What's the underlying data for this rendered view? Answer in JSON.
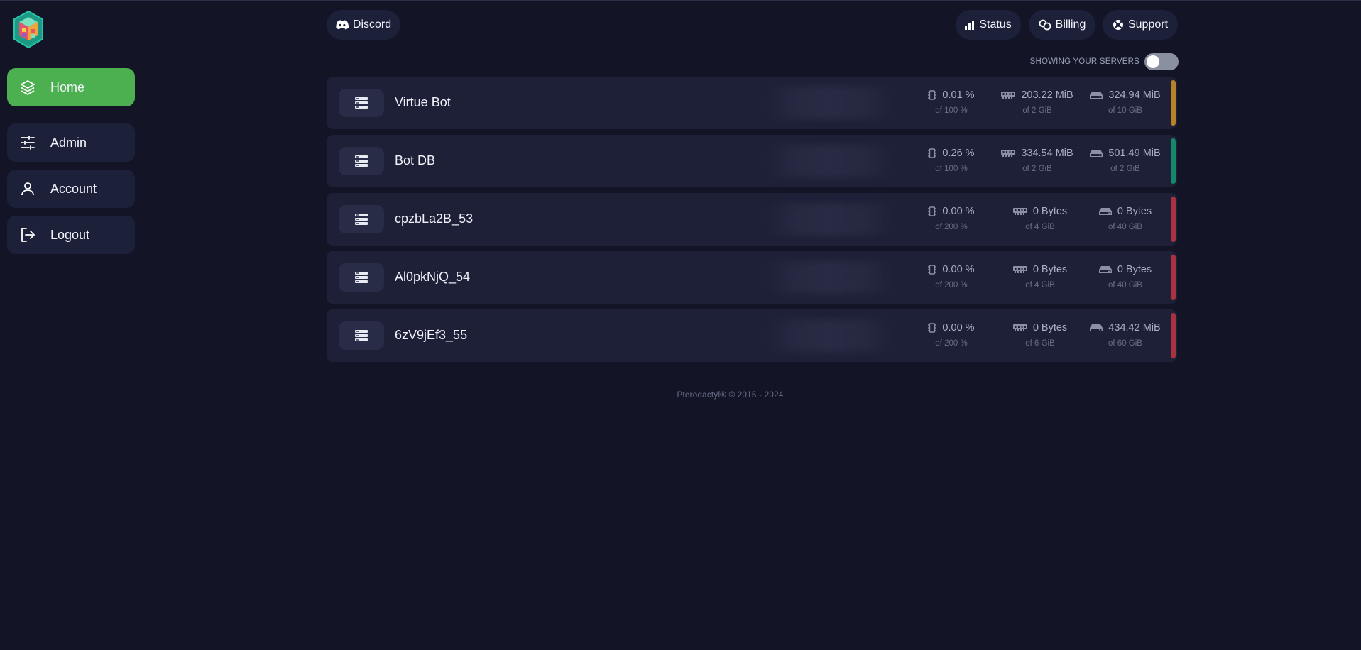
{
  "sidebar": {
    "items": [
      {
        "label": "Home",
        "icon": "layers-icon",
        "active": true
      },
      {
        "label": "Admin",
        "icon": "sliders-icon",
        "active": false
      },
      {
        "label": "Account",
        "icon": "user-icon",
        "active": false
      },
      {
        "label": "Logout",
        "icon": "logout-icon",
        "active": false
      }
    ]
  },
  "topbar": {
    "discord_label": "Discord",
    "status_label": "Status",
    "billing_label": "Billing",
    "support_label": "Support"
  },
  "filter": {
    "label": "SHOWING YOUR SERVERS",
    "toggle_on": false
  },
  "servers": [
    {
      "name": "Virtue Bot",
      "cpu": "0.01 %",
      "cpu_limit": "of 100 %",
      "memory": "203.22 MiB",
      "memory_limit": "of 2 GiB",
      "disk": "324.94 MiB",
      "disk_limit": "of 10 GiB",
      "status_color": "#b8822b"
    },
    {
      "name": "Bot DB",
      "cpu": "0.26 %",
      "cpu_limit": "of 100 %",
      "memory": "334.54 MiB",
      "memory_limit": "of 2 GiB",
      "disk": "501.49 MiB",
      "disk_limit": "of 2 GiB",
      "status_color": "#15876b"
    },
    {
      "name": "cpzbLa2B_53",
      "cpu": "0.00 %",
      "cpu_limit": "of 200 %",
      "memory": "0 Bytes",
      "memory_limit": "of 4 GiB",
      "disk": "0 Bytes",
      "disk_limit": "of 40 GiB",
      "status_color": "#a8323f"
    },
    {
      "name": "Al0pkNjQ_54",
      "cpu": "0.00 %",
      "cpu_limit": "of 200 %",
      "memory": "0 Bytes",
      "memory_limit": "of 4 GiB",
      "disk": "0 Bytes",
      "disk_limit": "of 40 GiB",
      "status_color": "#a8323f"
    },
    {
      "name": "6zV9jEf3_55",
      "cpu": "0.00 %",
      "cpu_limit": "of 200 %",
      "memory": "0 Bytes",
      "memory_limit": "of 6 GiB",
      "disk": "434.42 MiB",
      "disk_limit": "of 60 GiB",
      "status_color": "#a8323f"
    }
  ],
  "footer": {
    "text": "Pterodactyl® © 2015 - 2024"
  },
  "colors": {
    "background": "#131527",
    "card": "#1e2038",
    "accent": "#4caf50"
  }
}
